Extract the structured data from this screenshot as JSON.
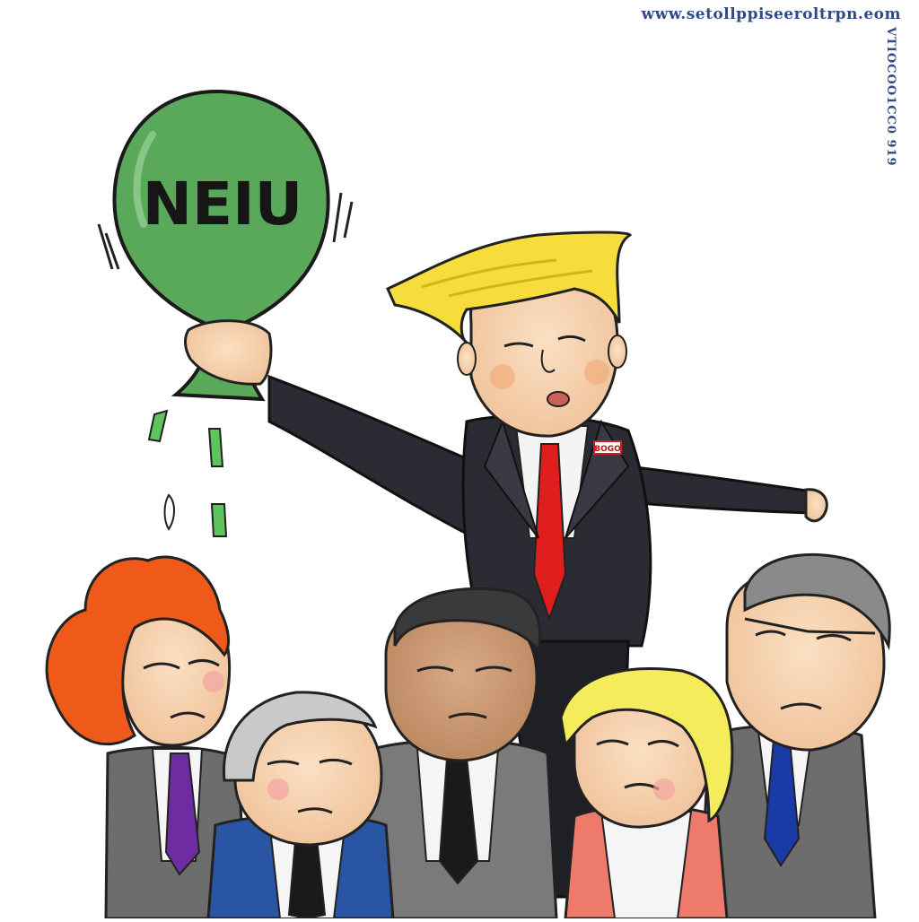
{
  "watermark": {
    "url": "www.setollppiseeroltrpn.eom",
    "vertical": "VTIOCOO1CC0 919"
  },
  "balloon": {
    "label": "NEIU"
  },
  "pin_badge": {
    "text": "BOGO"
  },
  "colors": {
    "balloon": "#5aa85a",
    "hair_center": "#f7dd3c",
    "suit_dark": "#2b2b33",
    "tie_red": "#e01e1e",
    "hair_red": "#ef5a1b",
    "blazer_blue": "#2a55a5",
    "jacket_pink": "#ee7a6c",
    "suit_gray": "#6d6d6d"
  },
  "figures": [
    "center-man-with-balloon",
    "red-haired-woman",
    "white-haired-man-blue-suit",
    "dark-haired-man-gray-suit",
    "blonde-woman-pink-jacket",
    "gray-haired-man-glasses"
  ]
}
